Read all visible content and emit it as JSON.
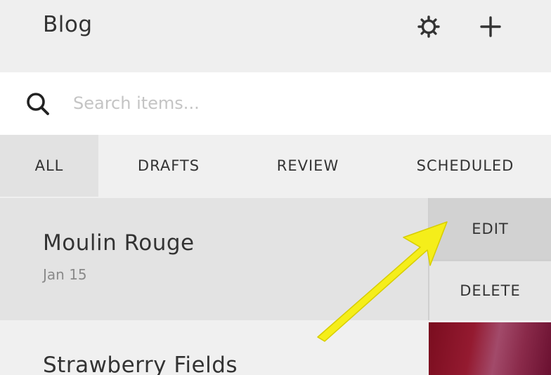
{
  "header": {
    "title": "Blog",
    "settings_icon": "gear-icon",
    "add_icon": "plus-icon"
  },
  "search": {
    "placeholder": "Search items...",
    "value": ""
  },
  "tabs": [
    {
      "label": "ALL",
      "active": true
    },
    {
      "label": "DRAFTS",
      "active": false
    },
    {
      "label": "REVIEW",
      "active": false
    },
    {
      "label": "SCHEDULED",
      "active": false
    }
  ],
  "items": [
    {
      "title": "Moulin Rouge",
      "date": "Jan 15"
    },
    {
      "title": "Strawberry Fields"
    }
  ],
  "row_actions": {
    "edit_label": "EDIT",
    "delete_label": "DELETE"
  },
  "annotation": {
    "type": "arrow",
    "color": "#f5ee1a"
  }
}
